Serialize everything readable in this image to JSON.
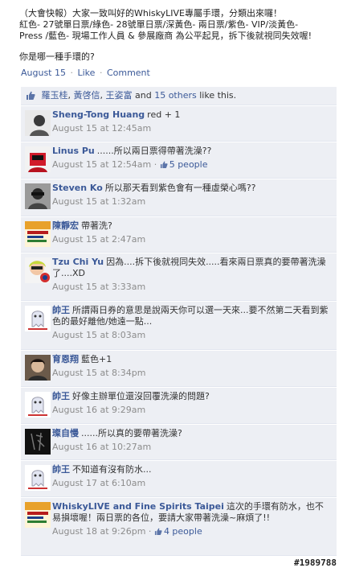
{
  "post": {
    "lines": [
      "（大會快報）大家一致叫好的WhiskyLIVE專屬手環，分類出來囉！",
      "紅色- 27號單日票/綠色- 28號單日票/深黃色- 兩日票/紫色- VIP/淡黃色-",
      "Press /藍色- 現場工作人員 & 參展廠商 為公平起見，拆下後就視同失效喔!"
    ],
    "question": "你是哪一種手環的?",
    "date": "August 15",
    "like": "Like",
    "comment": "Comment"
  },
  "likes": {
    "names": [
      "羅玉桂",
      "黃啓信",
      "王姿富"
    ],
    "sep1": ", ",
    "sep2": ", ",
    "and": " and ",
    "others": "15 others",
    "suffix": " like this."
  },
  "comments": [
    {
      "author": "Sheng-Tong Huang",
      "text": "red + 1",
      "time": "August 15 at 12:45am",
      "likes": ""
    },
    {
      "author": "Linus Pu",
      "text": "......所以兩日票得帶著洗澡??",
      "time": "August 15 at 12:54am",
      "likes": "5 people"
    },
    {
      "author": "Steven Ko",
      "text": "所以那天看到紫色會有一種虛榮心嗎??",
      "time": "August 15 at 1:32am",
      "likes": ""
    },
    {
      "author": "陳靜宏",
      "text": "帶著洗?",
      "time": "August 15 at 2:47am",
      "likes": ""
    },
    {
      "author": "Tzu Chi Yu",
      "text": "因為....拆下後就視同失效.....看來兩日票真的要帶著洗澡了....XD",
      "time": "August 15 at 3:33am",
      "likes": ""
    },
    {
      "author": "帥王",
      "text": "所謂兩日券的意思是說兩天你可以選一天來...要不然第二天看到紫色的最好離他/她遠一點...",
      "time": "August 15 at 8:03am",
      "likes": ""
    },
    {
      "author": "育恩翔",
      "text": "藍色+1",
      "time": "August 15 at 8:34pm",
      "likes": ""
    },
    {
      "author": "帥王",
      "text": "好像主辦單位還沒回覆洗澡的問題?",
      "time": "August 16 at 9:29am",
      "likes": ""
    },
    {
      "author": "璨自慢",
      "text": "......所以真的要帶著洗澡?",
      "time": "August 16 at 10:27am",
      "likes": ""
    },
    {
      "author": "帥王",
      "text": "不知道有沒有防水...",
      "time": "August 17 at 6:10am",
      "likes": ""
    },
    {
      "author": "WhiskyLIVE and Fine Spirits Taipei",
      "text": "這次的手環有防水，也不易損壞喔！兩日票的各位，要請大家帶著洗澡~麻煩了!!",
      "time": "August 18 at 9:26pm",
      "likes": "4 people"
    }
  ],
  "watermark": "#1989788",
  "colors": {
    "link": "#3b5998",
    "panel": "#edeff4",
    "meta": "#8c8c8c"
  }
}
